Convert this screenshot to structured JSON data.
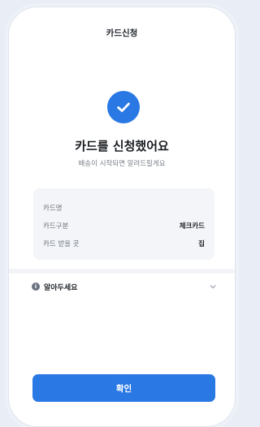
{
  "header": {
    "title": "카드신청"
  },
  "status": {
    "icon": "check-icon",
    "title": "카드를 신청했어요",
    "subtitle": "배송이 시작되면 알려드릴게요"
  },
  "card_info": {
    "rows": [
      {
        "label": "카드명",
        "value": ""
      },
      {
        "label": "카드구분",
        "value": "체크카드"
      },
      {
        "label": "카드 받을 곳",
        "value": "집"
      }
    ]
  },
  "notice": {
    "icon": "info-icon",
    "label": "알아두세요",
    "chevron": "chevron-down-icon"
  },
  "footer": {
    "confirm_label": "확인"
  },
  "colors": {
    "accent": "#2a78e4",
    "card_bg": "#f3f5f8"
  }
}
